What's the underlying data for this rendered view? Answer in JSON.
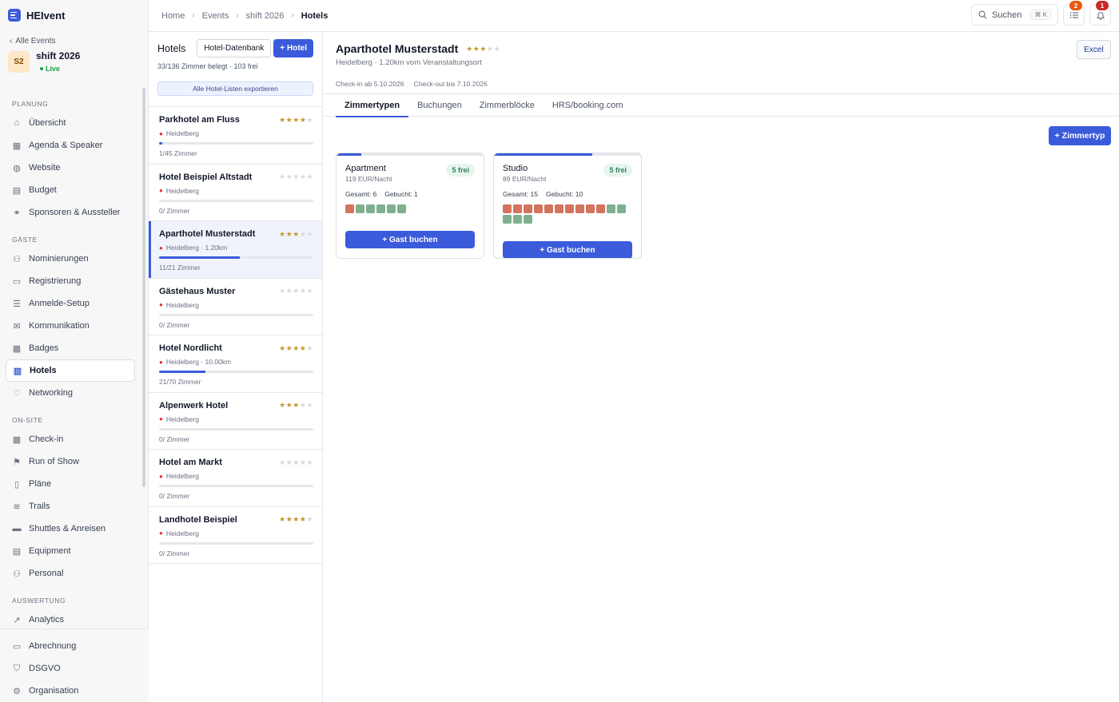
{
  "brand": {
    "name": "HEIvent"
  },
  "event": {
    "back_label": "Alle Events",
    "initials": "S2",
    "name": "shift 2026",
    "status": "Live"
  },
  "nav": {
    "sections": [
      {
        "title": "PLANUNG",
        "items": [
          {
            "label": "Übersicht",
            "icon": "home-icon"
          },
          {
            "label": "Agenda & Speaker",
            "icon": "calendar-icon"
          },
          {
            "label": "Website",
            "icon": "globe-icon"
          },
          {
            "label": "Budget",
            "icon": "budget-icon"
          },
          {
            "label": "Sponsoren & Aussteller",
            "icon": "handshake-icon"
          }
        ]
      },
      {
        "title": "GÄSTE",
        "items": [
          {
            "label": "Nominierungen",
            "icon": "user-plus-icon"
          },
          {
            "label": "Registrierung",
            "icon": "ticket-icon"
          },
          {
            "label": "Anmelde-Setup",
            "icon": "sliders-icon"
          },
          {
            "label": "Kommunikation",
            "icon": "mail-icon"
          },
          {
            "label": "Badges",
            "icon": "qr-icon"
          },
          {
            "label": "Hotels",
            "icon": "building-icon",
            "active": true
          },
          {
            "label": "Networking",
            "icon": "heart-icon"
          }
        ]
      },
      {
        "title": "ON-SITE",
        "items": [
          {
            "label": "Check-in",
            "icon": "scan-icon"
          },
          {
            "label": "Run of Show",
            "icon": "flag-icon"
          },
          {
            "label": "Pläne",
            "icon": "map-icon"
          },
          {
            "label": "Trails",
            "icon": "route-icon"
          },
          {
            "label": "Shuttles & Anreisen",
            "icon": "bus-icon"
          },
          {
            "label": "Equipment",
            "icon": "clipboard-icon"
          },
          {
            "label": "Personal",
            "icon": "users-icon"
          }
        ]
      },
      {
        "title": "AUSWERTUNG",
        "items": [
          {
            "label": "Analytics",
            "icon": "trend-icon"
          },
          {
            "label": "Leads",
            "icon": "user-icon"
          }
        ]
      }
    ],
    "bottom": [
      {
        "label": "Abrechnung",
        "icon": "card-icon"
      },
      {
        "label": "DSGVO",
        "icon": "shield-icon"
      },
      {
        "label": "Organisation",
        "icon": "gear-icon"
      }
    ]
  },
  "breadcrumb": [
    "Home",
    "Events",
    "shift 2026",
    "Hotels"
  ],
  "topbar": {
    "search_label": "Suchen",
    "search_kbd": "⌘ K",
    "tasks_count": "2",
    "notifications_count": "1",
    "tasks_badge_color": "#e8590c",
    "notifications_badge_color": "#c92a2a"
  },
  "hotel_list": {
    "title": "Hotels",
    "db_button": "Hotel-Datenbank",
    "add_button": "+ Hotel",
    "summary": "33/136 Zimmer belegt · 103 frei",
    "export_button": "Alle Hotel-Listen exportieren",
    "items": [
      {
        "name": "Parkhotel am Fluss",
        "stars": 4,
        "location": "Heidelberg",
        "rooms": "1/45 Zimmer",
        "occupancy": 0.022
      },
      {
        "name": "Hotel Beispiel Altstadt",
        "stars": 0,
        "location": "Heidelberg",
        "rooms": "0/ Zimmer",
        "occupancy": 0
      },
      {
        "name": "Aparthotel Musterstadt",
        "stars": 3,
        "location": "Heidelberg · 1.20km",
        "rooms": "11/21 Zimmer",
        "occupancy": 0.524,
        "active": true
      },
      {
        "name": "Gästehaus Muster",
        "stars": 0,
        "location": "Heidelberg",
        "rooms": "0/ Zimmer",
        "occupancy": 0
      },
      {
        "name": "Hotel Nordlicht",
        "stars": 4,
        "location": "Heidelberg · 10.00km",
        "rooms": "21/70 Zimmer",
        "occupancy": 0.3
      },
      {
        "name": "Alpenwerk Hotel",
        "stars": 3,
        "location": "Heidelberg",
        "rooms": "0/ Zimmer",
        "occupancy": 0
      },
      {
        "name": "Hotel am Markt",
        "stars": 0,
        "location": "Heidelberg",
        "rooms": "0/ Zimmer",
        "occupancy": 0
      },
      {
        "name": "Landhotel Beispiel",
        "stars": 4,
        "location": "Heidelberg",
        "rooms": "0/ Zimmer",
        "occupancy": 0
      }
    ]
  },
  "detail": {
    "title": "Aparthotel Musterstadt",
    "stars": 3,
    "subtitle": "Heidelberg · 1.20km vom Veranstaltungsort",
    "checkin": "Check-in ab 5.10.2026",
    "checkout": "Check-out bis 7.10.2026",
    "excel_button": "Excel",
    "tabs": [
      "Zimmertypen",
      "Buchungen",
      "Zimmerblöcke",
      "HRS/booking.com"
    ],
    "active_tab": 0,
    "add_room_type_button": "+ Zimmertyp",
    "room_types": [
      {
        "name": "Apartment",
        "free_label": "5 frei",
        "price": "119 EUR/Nacht",
        "total_label": "Gesamt: 6",
        "booked_label": "Gebucht: 1",
        "total": 6,
        "booked": 1,
        "book_button": "+ Gast buchen"
      },
      {
        "name": "Studio",
        "free_label": "5 frei",
        "price": "89 EUR/Nacht",
        "total_label": "Gesamt: 15",
        "booked_label": "Gebucht: 10",
        "total": 15,
        "booked": 10,
        "book_button": "+ Gast buchen"
      }
    ]
  }
}
